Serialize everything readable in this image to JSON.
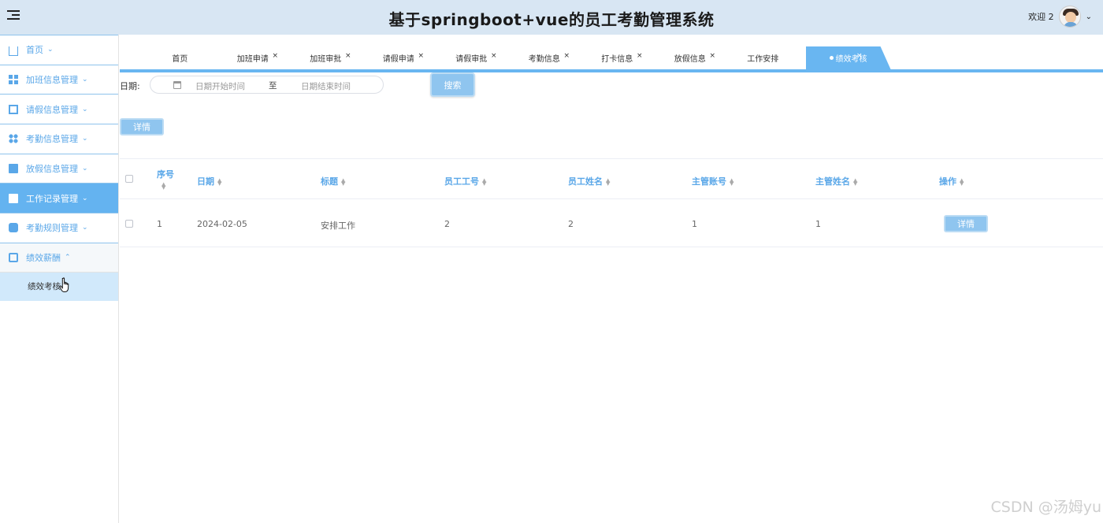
{
  "header": {
    "title": "基于springboot+vue的员工考勤管理系统",
    "welcome": "欢迎 2"
  },
  "sidebar": {
    "items": [
      {
        "label": "首页",
        "icon": "home-icon"
      },
      {
        "label": "加班信息管理",
        "icon": "grid-icon"
      },
      {
        "label": "请假信息管理",
        "icon": "card-icon"
      },
      {
        "label": "考勤信息管理",
        "icon": "dots-icon"
      },
      {
        "label": "放假信息管理",
        "icon": "rect-icon"
      },
      {
        "label": "工作记录管理",
        "icon": "doc-icon"
      },
      {
        "label": "考勤规则管理",
        "icon": "mail-icon"
      },
      {
        "label": "绩效薪酬",
        "icon": "badge-icon"
      }
    ],
    "sub_item": "绩效考核"
  },
  "tabs": [
    {
      "label": "首页",
      "closable": false
    },
    {
      "label": "加班申请",
      "closable": true
    },
    {
      "label": "加班审批",
      "closable": true
    },
    {
      "label": "请假申请",
      "closable": true
    },
    {
      "label": "请假审批",
      "closable": true
    },
    {
      "label": "考勤信息",
      "closable": true
    },
    {
      "label": "打卡信息",
      "closable": true
    },
    {
      "label": "放假信息",
      "closable": true
    },
    {
      "label": "工作安排",
      "closable": false
    },
    {
      "label": "绩效考核",
      "closable": true,
      "active": true
    }
  ],
  "tab_close": "×",
  "search": {
    "label": "日期:",
    "start_placeholder": "日期开始时间",
    "separator": "至",
    "end_placeholder": "日期结束时间",
    "button": "搜索"
  },
  "detail_button": "详情",
  "table": {
    "columns": [
      "序号",
      "日期",
      "标题",
      "员工工号",
      "员工姓名",
      "主管账号",
      "主管姓名",
      "操作"
    ],
    "rows": [
      {
        "index": "1",
        "date": "2024-02-05",
        "title": "安排工作",
        "emp_no": "2",
        "emp_name": "2",
        "mgr_account": "1",
        "mgr_name": "1",
        "action": "详情"
      }
    ]
  },
  "watermark": "CSDN @汤姆yu",
  "colors": {
    "accent": "#69b6f1",
    "header_bg": "#d8e6f3",
    "sidebar_text": "#5aa7e8"
  }
}
